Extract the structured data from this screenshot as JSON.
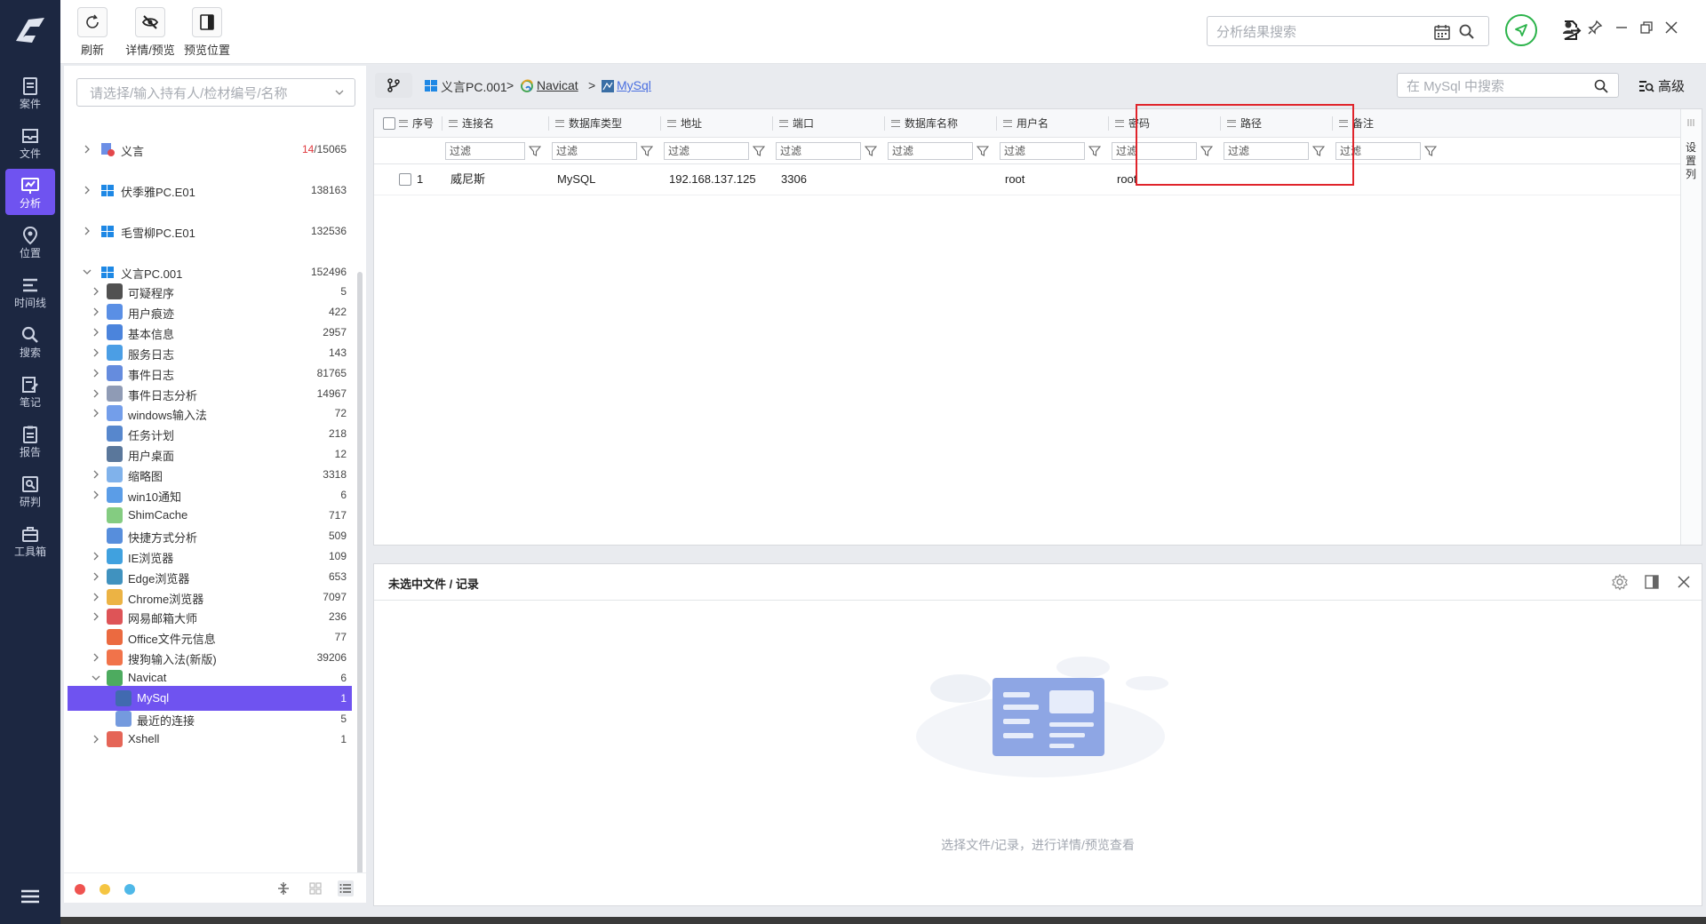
{
  "nav": {
    "items": [
      {
        "label": "案件",
        "icon": "case-icon"
      },
      {
        "label": "文件",
        "icon": "folder-icon"
      },
      {
        "label": "分析",
        "icon": "analysis-icon",
        "active": true
      },
      {
        "label": "位置",
        "icon": "location-icon"
      },
      {
        "label": "时间线",
        "icon": "timeline-icon"
      },
      {
        "label": "搜索",
        "icon": "search-icon"
      },
      {
        "label": "笔记",
        "icon": "note-icon"
      },
      {
        "label": "报告",
        "icon": "report-icon"
      },
      {
        "label": "研判",
        "icon": "judge-icon"
      },
      {
        "label": "工具箱",
        "icon": "toolbox-icon"
      }
    ]
  },
  "toolbar": {
    "refresh": "刷新",
    "detail_preview": "详情/预览",
    "preview_position": "预览位置",
    "result_search_placeholder": "分析结果搜索"
  },
  "tree": {
    "search_placeholder": "请选择/输入持有人/检材编号/名称",
    "roots": [
      {
        "label": "义言",
        "count_hit": "14",
        "count_total": "/15065"
      },
      {
        "label": "伏季雅PC.E01",
        "count": "138163"
      },
      {
        "label": "毛雪柳PC.E01",
        "count": "132536"
      },
      {
        "label": "义言PC.001",
        "count": "152496"
      }
    ],
    "children": [
      {
        "label": "可疑程序",
        "count": "5"
      },
      {
        "label": "用户痕迹",
        "count": "422"
      },
      {
        "label": "基本信息",
        "count": "2957"
      },
      {
        "label": "服务日志",
        "count": "143"
      },
      {
        "label": "事件日志",
        "count": "81765"
      },
      {
        "label": "事件日志分析",
        "count": "14967"
      },
      {
        "label": "windows输入法",
        "count": "72"
      },
      {
        "label": "任务计划",
        "count": "218"
      },
      {
        "label": "用户桌面",
        "count": "12"
      },
      {
        "label": "缩略图",
        "count": "3318"
      },
      {
        "label": "win10通知",
        "count": "6"
      },
      {
        "label": "ShimCache",
        "count": "717"
      },
      {
        "label": "快捷方式分析",
        "count": "509"
      },
      {
        "label": "IE浏览器",
        "count": "109"
      },
      {
        "label": "Edge浏览器",
        "count": "653"
      },
      {
        "label": "Chrome浏览器",
        "count": "7097"
      },
      {
        "label": "网易邮箱大师",
        "count": "236"
      },
      {
        "label": "Office文件元信息",
        "count": "77"
      },
      {
        "label": "搜狗输入法(新版)",
        "count": "39206"
      },
      {
        "label": "Navicat",
        "count": "6"
      },
      {
        "label": "MySql",
        "count": "1"
      },
      {
        "label": "最近的连接",
        "count": "5"
      },
      {
        "label": "Xshell",
        "count": "1"
      }
    ]
  },
  "breadcrumb": {
    "items": [
      "义言PC.001",
      "Navicat",
      "MySql"
    ],
    "separator": ">"
  },
  "table_search_placeholder": "在 MySql 中搜索",
  "advanced_label": "高级",
  "table": {
    "columns": [
      "序号",
      "连接名",
      "数据库类型",
      "地址",
      "端口",
      "数据库名称",
      "用户名",
      "密码",
      "路径",
      "备注"
    ],
    "filter_placeholder": "过滤",
    "rows": [
      {
        "index": "1",
        "name": "威尼斯",
        "db_type": "MySQL",
        "address": "192.168.137.125",
        "port": "3306",
        "db_name": "",
        "user": "root",
        "password": "root",
        "path": "",
        "note": ""
      }
    ],
    "column_settings": "设置列"
  },
  "preview": {
    "title": "未选中文件 / 记录",
    "empty_text": "选择文件/记录，进行详情/预览查看"
  },
  "colors": {
    "nav_bg": "#1c2741",
    "accent": "#6f53f0",
    "highlight": "#e0242b",
    "success": "#2bb34a"
  }
}
